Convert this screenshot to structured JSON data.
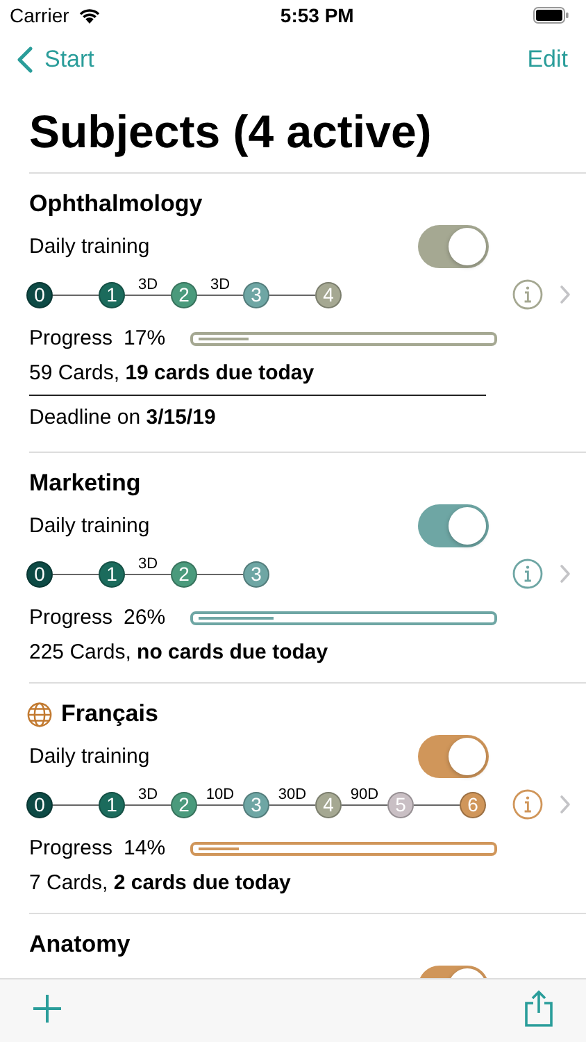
{
  "status_bar": {
    "carrier": "Carrier",
    "time": "5:53 PM"
  },
  "nav": {
    "back": "Start",
    "edit": "Edit"
  },
  "title": "Subjects (4 active)",
  "subjects": [
    {
      "name": "Ophthalmology",
      "globe": false,
      "color": "#a5a892",
      "training_label": "Daily training",
      "training_on": true,
      "stages": [
        {
          "label": "0",
          "color": "#0d4a45"
        },
        {
          "label": "1",
          "color": "#1b6b5c"
        },
        {
          "label": "2",
          "color": "#4a9a7c",
          "interval": "3D"
        },
        {
          "label": "3",
          "color": "#6ea6a4",
          "interval": "3D"
        },
        {
          "label": "4",
          "color": "#a5a892"
        }
      ],
      "progress_label": "Progress",
      "progress_value": "17%",
      "level": 0.17,
      "cards": "59 Cards, **19 cards due today**",
      "deadline": "Deadline on **3/15/19**"
    },
    {
      "name": "Marketing",
      "globe": false,
      "color": "#6ea6a4",
      "training_label": "Daily training",
      "training_on": true,
      "stages": [
        {
          "label": "0",
          "color": "#0d4a45"
        },
        {
          "label": "1",
          "color": "#1b6b5c"
        },
        {
          "label": "2",
          "color": "#4a9a7c",
          "interval": "3D"
        },
        {
          "label": "3",
          "color": "#6ea6a4"
        }
      ],
      "progress_label": "Progress",
      "progress_value": "26%",
      "level": 0.26,
      "cards": "225 Cards, **no cards due today**"
    },
    {
      "name": "Français",
      "globe": true,
      "color": "#d0965a",
      "training_label": "Daily training",
      "training_on": true,
      "stages": [
        {
          "label": "0",
          "color": "#0d4a45"
        },
        {
          "label": "1",
          "color": "#1b6b5c"
        },
        {
          "label": "2",
          "color": "#4a9a7c",
          "interval": "3D"
        },
        {
          "label": "3",
          "color": "#6ea6a4",
          "interval": "10D"
        },
        {
          "label": "4",
          "color": "#a5a892",
          "interval": "30D"
        },
        {
          "label": "5",
          "color": "#c9bfc4",
          "interval": "90D"
        },
        {
          "label": "6",
          "color": "#d0965a"
        }
      ],
      "progress_label": "Progress",
      "progress_value": "14%",
      "level": 0.14,
      "cards": "7 Cards, **2 cards due today**"
    },
    {
      "name": "Anatomy",
      "globe": false,
      "color": "#d0965a",
      "training_on": true
    }
  ]
}
